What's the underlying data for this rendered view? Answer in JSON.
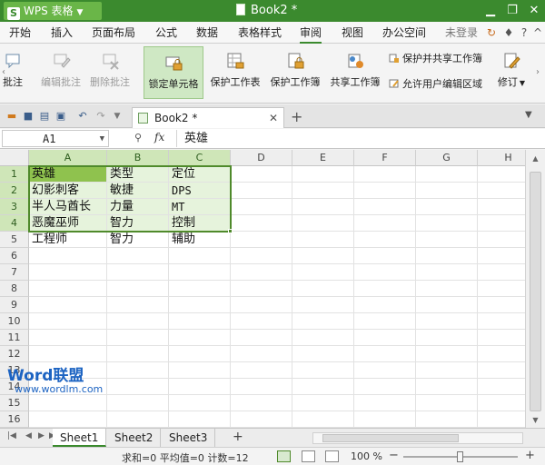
{
  "app": {
    "brand": "WPS 表格",
    "document_title": "Book2 *",
    "accent_color": "#3b8a2e",
    "window_controls": [
      "minimize-icon",
      "restore-icon",
      "close-icon"
    ]
  },
  "menu": {
    "items": [
      "开始",
      "插入",
      "页面布局",
      "公式",
      "数据",
      "表格样式",
      "审阅",
      "视图",
      "办公空间"
    ],
    "active": "审阅",
    "login": "未登录"
  },
  "ribbon": {
    "buttons": [
      {
        "label": "批注",
        "icon": "comment-icon",
        "enabled": true
      },
      {
        "label": "编辑批注",
        "icon": "edit-comment-icon",
        "enabled": false
      },
      {
        "label": "删除批注",
        "icon": "delete-comment-icon",
        "enabled": false
      },
      {
        "label": "锁定单元格",
        "icon": "lock-cell-icon",
        "enabled": true,
        "selected": true
      },
      {
        "label": "保护工作表",
        "icon": "protect-sheet-icon",
        "enabled": true
      },
      {
        "label": "保护工作簿",
        "icon": "protect-workbook-icon",
        "enabled": true
      },
      {
        "label": "共享工作簿",
        "icon": "share-workbook-icon",
        "enabled": true
      }
    ],
    "small_buttons": [
      {
        "label": "保护并共享工作簿",
        "icon": "protect-share-icon"
      },
      {
        "label": "允许用户编辑区域",
        "icon": "allow-edit-ranges-icon"
      }
    ],
    "track_changes": {
      "label": "修订",
      "icon": "track-changes-icon"
    }
  },
  "tabs": {
    "document_tab": "Book2 *",
    "new_tab": "+"
  },
  "formula_bar": {
    "name_box": "A1",
    "fx": "fx",
    "content": "英雄"
  },
  "sheet": {
    "columns": [
      "A",
      "B",
      "C",
      "D",
      "E",
      "F",
      "G",
      "H"
    ],
    "rows": [
      "1",
      "2",
      "3",
      "4",
      "5",
      "6",
      "7",
      "8",
      "9",
      "10",
      "11",
      "12",
      "13",
      "14",
      "15",
      "16"
    ],
    "selected_columns": [
      "A",
      "B",
      "C"
    ],
    "selected_rows": [
      "1",
      "2",
      "3",
      "4"
    ],
    "active_cell": "A1",
    "cells": [
      [
        "英雄",
        "类型",
        "定位"
      ],
      [
        "幻影刺客",
        "敏捷",
        "DPS"
      ],
      [
        "半人马酋长",
        "力量",
        "MT"
      ],
      [
        "恶魔巫师",
        "智力",
        "控制"
      ],
      [
        "工程师",
        "智力",
        "辅助"
      ]
    ]
  },
  "watermark": {
    "word": "Word联盟",
    "url": "www.wordlm.com"
  },
  "sheet_tabs": {
    "names": [
      "Sheet1",
      "Sheet2",
      "Sheet3"
    ],
    "active": "Sheet1",
    "add": "+"
  },
  "status": {
    "sum": "求和=0",
    "avg": "平均值=0",
    "count": "计数=12",
    "zoom": "100 %",
    "zoom_percent": 100,
    "zoom_minus": "−",
    "zoom_plus": "+"
  }
}
